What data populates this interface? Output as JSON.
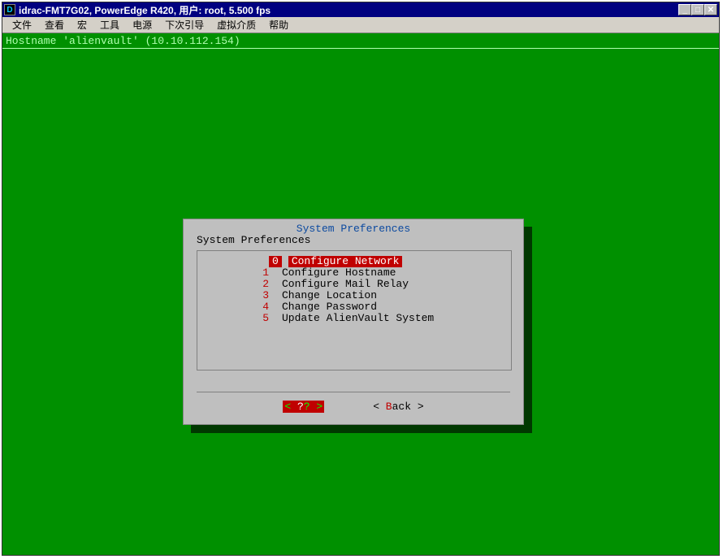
{
  "window": {
    "icon_letter": "D",
    "title": "idrac-FMT7G02, PowerEdge R420, 用户: root, 5.500 fps"
  },
  "menubar": {
    "items": [
      "文件",
      "查看",
      "宏",
      "工具",
      "电源",
      "下次引导",
      "虚拟介质",
      "帮助"
    ]
  },
  "console": {
    "hostname_line": "Hostname 'alienvault' (10.10.112.154)"
  },
  "dialog": {
    "title": "System Preferences",
    "subtitle": "System Preferences",
    "items": [
      {
        "num": "0",
        "label": "Configure Network",
        "selected": true
      },
      {
        "num": "1",
        "label": "Configure Hostname",
        "selected": false
      },
      {
        "num": "2",
        "label": "Configure Mail Relay",
        "selected": false
      },
      {
        "num": "3",
        "label": "Change Location",
        "selected": false
      },
      {
        "num": "4",
        "label": "Change Password",
        "selected": false
      },
      {
        "num": "5",
        "label": "Update AlienVault System",
        "selected": false
      }
    ],
    "buttons": {
      "ok": {
        "open": "<",
        "hot": " ?",
        "rest": "? ",
        "close": ">"
      },
      "back": {
        "open": "< ",
        "hot": "B",
        "rest": "ack ",
        "close": ">"
      }
    }
  }
}
